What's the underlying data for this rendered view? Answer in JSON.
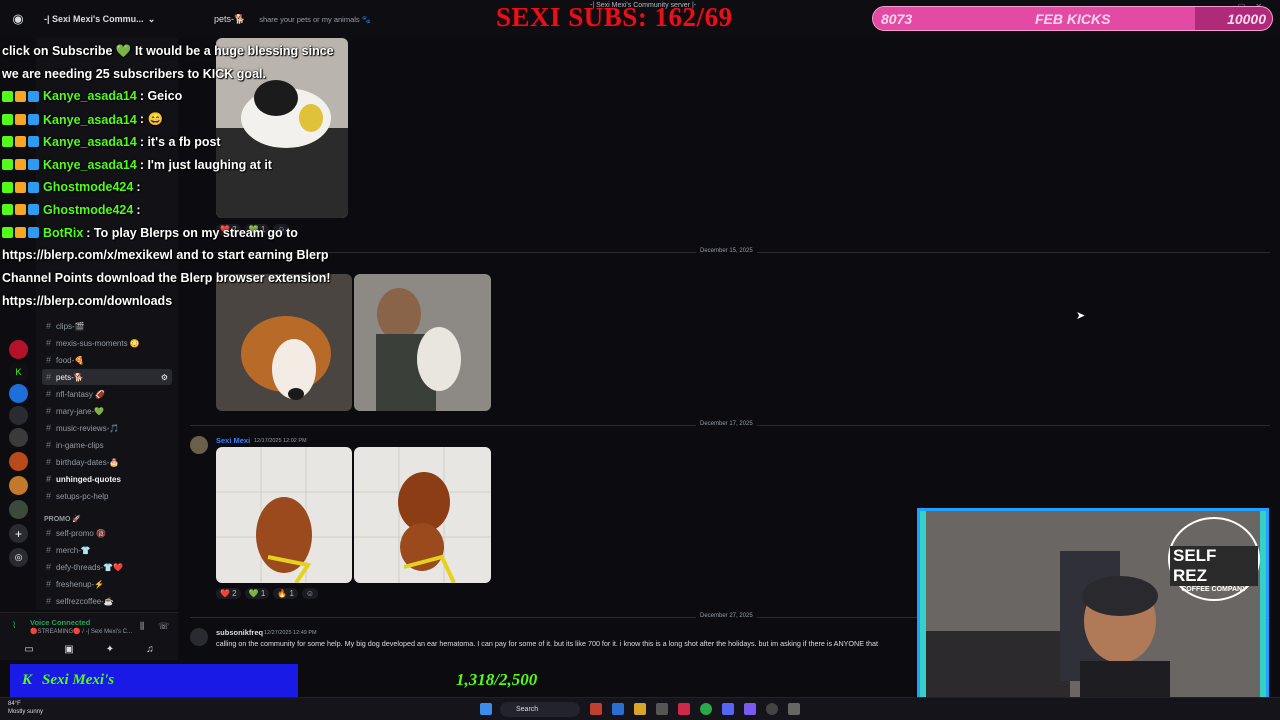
{
  "titlebar": {
    "window_title": "-| Sexi Mexi's Community server |-",
    "server": "-| Sexi Mexi's Commu...",
    "channel": "pets-🐕",
    "topic": "share your pets or my animals 🐾"
  },
  "overlay": {
    "subs": "SEXI SUBS: 162/69",
    "kicks_current": "8073",
    "kicks_label": "FEB KICKS",
    "kicks_goal": "10000",
    "kicks_progress": 0.807
  },
  "chat": [
    {
      "user": "",
      "text": "click on Subscribe 💚 It would be a huge blessing since"
    },
    {
      "user": "",
      "text": "we are needing 25 subscribers to KICK goal."
    },
    {
      "user": "Kanye_asada14",
      "text": ": Geico"
    },
    {
      "user": "Kanye_asada14",
      "text": ": 😄"
    },
    {
      "user": "Kanye_asada14",
      "text": ": it's a fb post"
    },
    {
      "user": "Kanye_asada14",
      "text": ": I'm just laughing at it"
    },
    {
      "user": "Ghostmode424",
      "text": ":"
    },
    {
      "user": "Ghostmode424",
      "text": ":"
    },
    {
      "user": "BotRix",
      "text": ": To play Blerps on my stream go to"
    },
    {
      "user": "",
      "text": "https://blerp.com/x/mexikewl and to start earning Blerp"
    },
    {
      "user": "",
      "text": "Channel Points download the Blerp browser extension!"
    },
    {
      "user": "",
      "text": "https://blerp.com/downloads"
    }
  ],
  "channels": [
    {
      "name": "clips-🎬",
      "selected": false,
      "bold": false
    },
    {
      "name": "mexis-sus-moments 😳",
      "selected": false,
      "bold": false
    },
    {
      "name": "food-🍕",
      "selected": false,
      "bold": false
    },
    {
      "name": "pets-🐕",
      "selected": true,
      "bold": false
    },
    {
      "name": "nfl-fantasy 🏈",
      "selected": false,
      "bold": false
    },
    {
      "name": "mary-jane-💚",
      "selected": false,
      "bold": false
    },
    {
      "name": "music-reviews-🎵",
      "selected": false,
      "bold": false
    },
    {
      "name": "in-game-clips",
      "selected": false,
      "bold": false
    },
    {
      "name": "birthday-dates-🎂",
      "selected": false,
      "bold": false
    },
    {
      "name": "unhinged-quotes",
      "selected": false,
      "bold": true
    },
    {
      "name": "setups-pc-help",
      "selected": false,
      "bold": false
    }
  ],
  "promo": {
    "category": "PROMO 🚀",
    "channels": [
      "self-promo 🔞",
      "merch-👕",
      "defy-threads-👕❤️",
      "freshenup-⚡",
      "selfrezcoffee-☕"
    ]
  },
  "voice": {
    "status": "Voice Connected",
    "detail": "🔴STREAMING🔴 / -| Sexi Mexi's C..."
  },
  "dividers": [
    "December 15, 2025",
    "December 17, 2025",
    "December 27, 2025"
  ],
  "messages": {
    "post1": {
      "user": "Sexi Mexi",
      "timestamp": "12/17/2025 12:02 PM"
    },
    "post2": {
      "user": "subsonikfreq",
      "timestamp": "12/27/2025 12:49 PM",
      "text": "calling on the community for some help. My big dog developed an ear hematoma. I can pay for some of it. but its like 700 for it. i know this is a long shot after the holidays. but im asking if there is ANYONE that"
    }
  },
  "reactions": {
    "r1": [
      "❤️ 2",
      "💚 1",
      "☺"
    ],
    "r2": [
      "❤️ 2",
      "💚 1",
      "🔥 1",
      "☺"
    ]
  },
  "webcam": {
    "logo_text": "SELF REZ",
    "logo_sub": "COFFEE COMPANY"
  },
  "bottom": {
    "subs_name": "Sexi Mexi's",
    "count": "1,318/2,500"
  },
  "taskbar": {
    "weather_temp": "84°F",
    "weather_desc": "Mostly sunny",
    "search": "Search"
  }
}
